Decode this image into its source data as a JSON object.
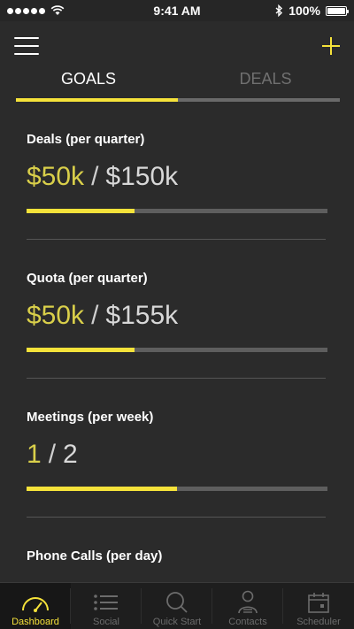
{
  "status_bar": {
    "time": "9:41 AM",
    "battery": "100%"
  },
  "header": {
    "menu_icon": "hamburger-menu-icon",
    "add_icon": "plus-icon",
    "accent_color": "#f5e23a"
  },
  "tabs": [
    {
      "label": "GOALS",
      "active": true
    },
    {
      "label": "DEALS",
      "active": false
    }
  ],
  "goals": [
    {
      "title": "Deals (per quarter)",
      "current": "$50k",
      "separator": "/",
      "target": "$150k",
      "progress": 0.36
    },
    {
      "title": "Quota (per quarter)",
      "current": "$50k",
      "separator": "/",
      "target": "$155k",
      "progress": 0.36
    },
    {
      "title": "Meetings (per week)",
      "current": "1",
      "separator": "/",
      "target": "2",
      "progress": 0.5
    },
    {
      "title": "Phone Calls (per day)",
      "current": "",
      "separator": "",
      "target": "",
      "progress": 0
    }
  ],
  "tabbar": [
    {
      "label": "Dashboard",
      "icon": "gauge-icon",
      "active": true
    },
    {
      "label": "Social",
      "icon": "list-icon",
      "active": false
    },
    {
      "label": "Quick Start",
      "icon": "search-icon",
      "active": false
    },
    {
      "label": "Contacts",
      "icon": "person-icon",
      "active": false
    },
    {
      "label": "Scheduler",
      "icon": "calendar-icon",
      "active": false
    }
  ]
}
